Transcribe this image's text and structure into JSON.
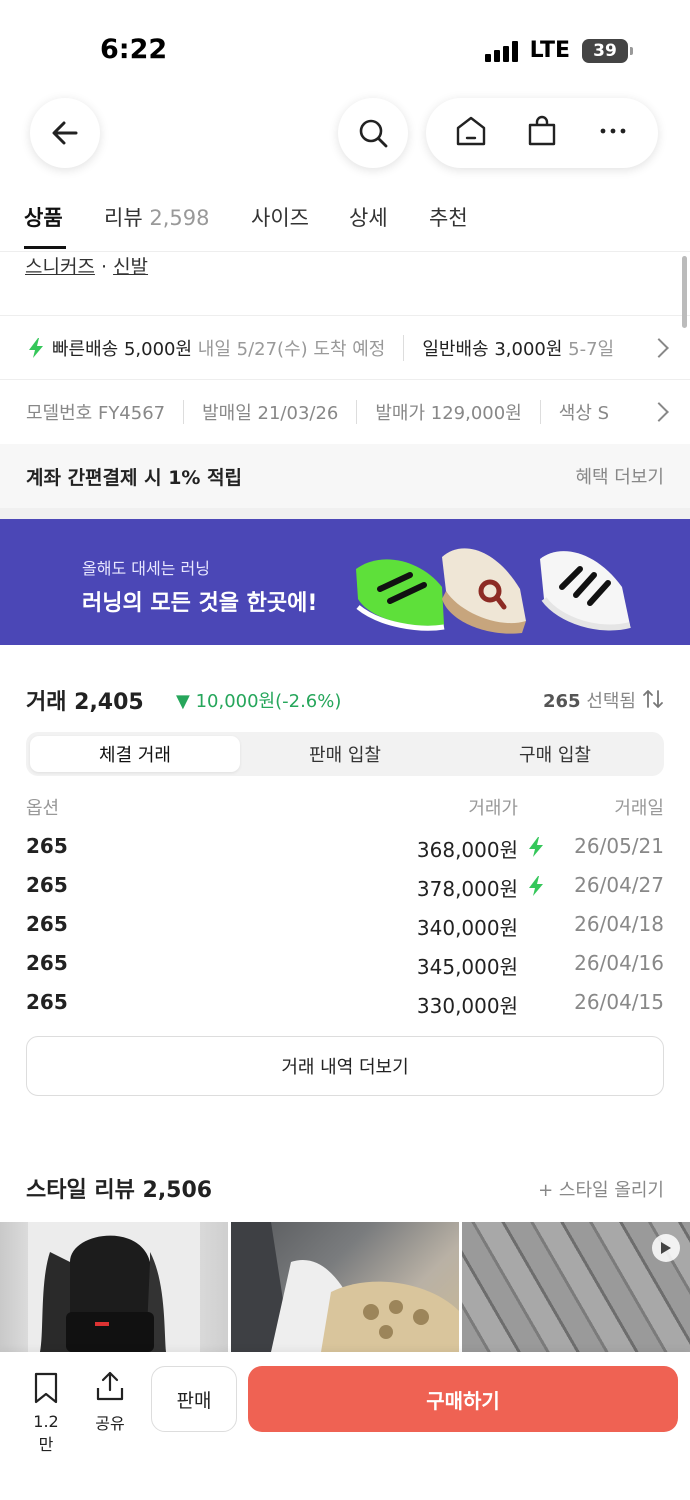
{
  "status": {
    "time": "6:22",
    "network": "LTE",
    "battery": "39"
  },
  "tabs": [
    {
      "label": "상품",
      "count": ""
    },
    {
      "label": "리뷰",
      "count": "2,598"
    },
    {
      "label": "사이즈",
      "count": ""
    },
    {
      "label": "상세",
      "count": ""
    },
    {
      "label": "추천",
      "count": ""
    }
  ],
  "category": {
    "first": "스니커즈",
    "dot": "·",
    "second": "신발"
  },
  "shipping": {
    "fast_label": "빠른배송 5,000원",
    "fast_eta": "내일 5/27(수) 도착 예정",
    "normal_label": "일반배송 3,000원",
    "normal_eta": "5-7일"
  },
  "specs": {
    "model": "모델번호 FY4567",
    "release": "발매일 21/03/26",
    "price": "발매가 129,000원",
    "color": "색상 S"
  },
  "benefit": {
    "title": "계좌 간편결제 시 1% 적립",
    "more": "혜택 더보기"
  },
  "banner": {
    "sub": "올해도 대세는 러닝",
    "main": "러닝의 모든 것을 한곳에!",
    "bg": "#4b47b6"
  },
  "trade": {
    "label": "거래 2,405",
    "change": "▼ 10,000원(-2.6%)",
    "selected_size": "265",
    "selected_label": "선택됨",
    "segments": [
      "체결 거래",
      "판매 입찰",
      "구매 입찰"
    ],
    "columns": [
      "옵션",
      "거래가",
      "거래일"
    ],
    "rows": [
      {
        "option": "265",
        "price": "368,000원",
        "fast": true,
        "date": "26/05/21"
      },
      {
        "option": "265",
        "price": "378,000원",
        "fast": true,
        "date": "26/04/27"
      },
      {
        "option": "265",
        "price": "340,000원",
        "fast": false,
        "date": "26/04/18"
      },
      {
        "option": "265",
        "price": "345,000원",
        "fast": false,
        "date": "26/04/16"
      },
      {
        "option": "265",
        "price": "330,000원",
        "fast": false,
        "date": "26/04/15"
      }
    ],
    "more_label": "거래 내역 더보기"
  },
  "style": {
    "title": "스타일 리뷰 2,506",
    "upload": "+ 스타일 올리기"
  },
  "bottom": {
    "bookmark_count": "1.2만",
    "share_label": "공유",
    "sell_label": "판매",
    "buy_label": "구매하기",
    "buy_color": "#ef6253"
  },
  "colors": {
    "accent_green": "#26a65b",
    "bolt_green": "#35c75a"
  }
}
